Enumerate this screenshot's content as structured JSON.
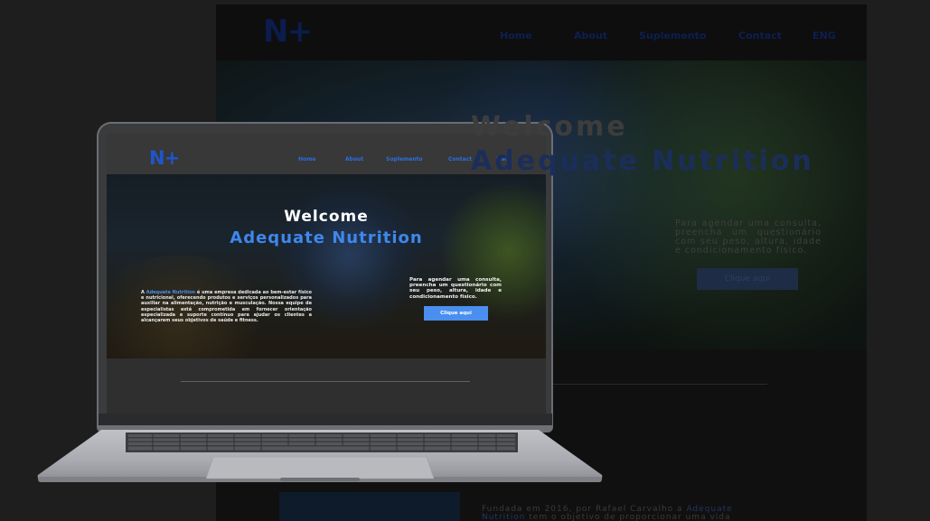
{
  "background_site": {
    "logo": "N+",
    "nav": [
      "Home",
      "About",
      "Suplemento",
      "Contact",
      "ENG"
    ],
    "title_line1": "Welcome",
    "title_line2": "Adequate Nutrition",
    "cta_text": "Para agendar uma consulta, preencha um questionário com seu peso, altura, idade e condicionamento físico.",
    "cta_button": "Clique aqui",
    "about_text_pre": "Fundada em 2016, por Rafael Carvalho a ",
    "about_highlight": "Adequate Nutrition",
    "about_text_post": " tem o objetivo de proporcionar uma vida saudável e"
  },
  "laptop_site": {
    "logo": "N+",
    "nav": {
      "home": "Home",
      "about": "About",
      "suplemento": "Suplemento",
      "contact": "Contact",
      "lang": "ENG"
    },
    "title_line1": "Welcome",
    "title_line2": "Adequate Nutrition",
    "intro_pre": "A ",
    "intro_highlight": "Adequate Nutrition",
    "intro_post": " é uma empresa dedicada ao bem-estar físico e nutricional, oferecendo produtos e serviços personalizados para auxiliar na alimentação, nutrição e musculação. Nossa equipe de especialistas está comprometida em fornecer orientação especializada e suporte contínuo para ajudar os clientes a alcançarem seus objetivos de saúde e fitness.",
    "cta_text": "Para agendar uma consulta, preencha um questionário com seu peso, altura, idade e condicionamento físico.",
    "cta_button": "Clique aqui"
  },
  "colors": {
    "accent": "#3f87ec",
    "logo": "#1e56c8",
    "page_background": "#1e1e1e"
  }
}
